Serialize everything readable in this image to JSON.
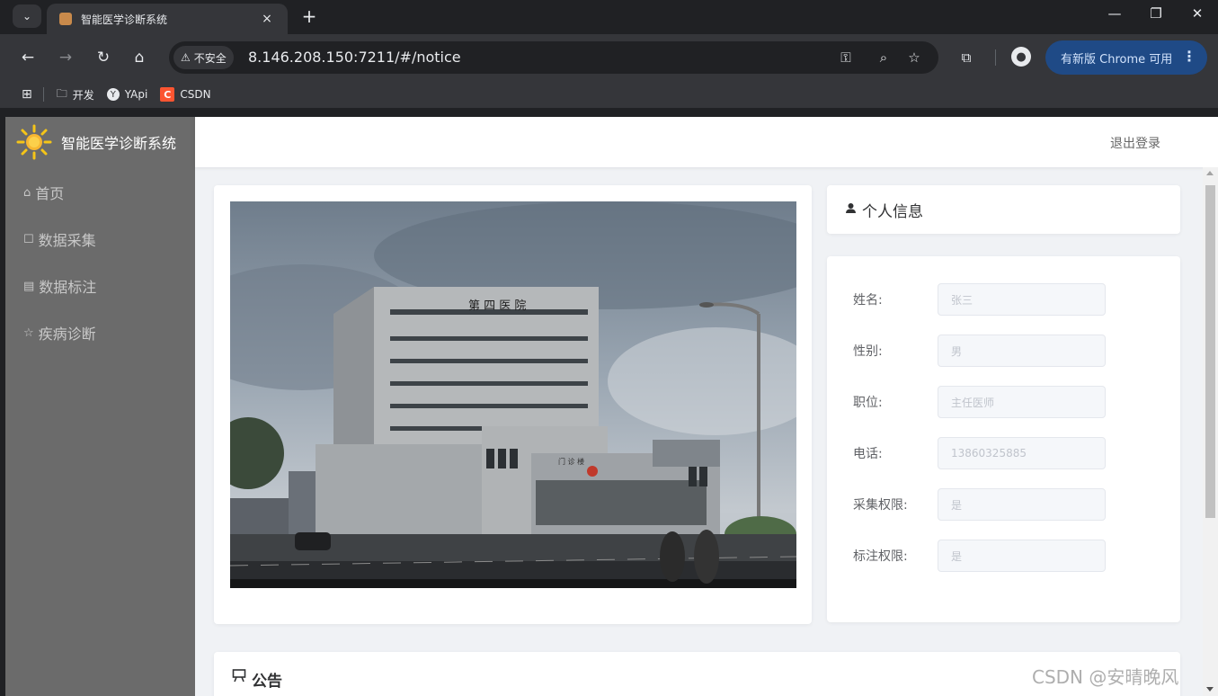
{
  "browser": {
    "tab_title": "智能医学诊断系统",
    "tab_close": "×",
    "new_tab": "+",
    "security_label": "不安全",
    "url": "8.146.208.150:7211/#/notice",
    "update_button": "有新版 Chrome 可用",
    "bookmarks": [
      {
        "label": "开发",
        "icon": "folder-icon"
      },
      {
        "label": "YApi",
        "icon": "yapi-icon"
      },
      {
        "label": "CSDN",
        "icon": "csdn-icon"
      }
    ]
  },
  "app": {
    "logo_title": "智能医学诊断系统",
    "logout": "退出登录",
    "menu": [
      {
        "label": "首页",
        "icon": "home-icon"
      },
      {
        "label": "数据采集",
        "icon": "collect-icon"
      },
      {
        "label": "数据标注",
        "icon": "annotate-icon"
      },
      {
        "label": "疾病诊断",
        "icon": "star-icon"
      }
    ],
    "photo": {
      "sign": "第 四 医 院",
      "small_sign": "门 诊 楼"
    },
    "profile": {
      "title": "个人信息",
      "fields": [
        {
          "label": "姓名:",
          "value": "张三"
        },
        {
          "label": "性别:",
          "value": "男"
        },
        {
          "label": "职位:",
          "value": "主任医师"
        },
        {
          "label": "电话:",
          "value": "13860325885"
        },
        {
          "label": "采集权限:",
          "value": "是"
        },
        {
          "label": "标注权限:",
          "value": "是"
        }
      ]
    },
    "notice": {
      "title": "公告"
    }
  },
  "watermark": "CSDN @安晴晚风"
}
